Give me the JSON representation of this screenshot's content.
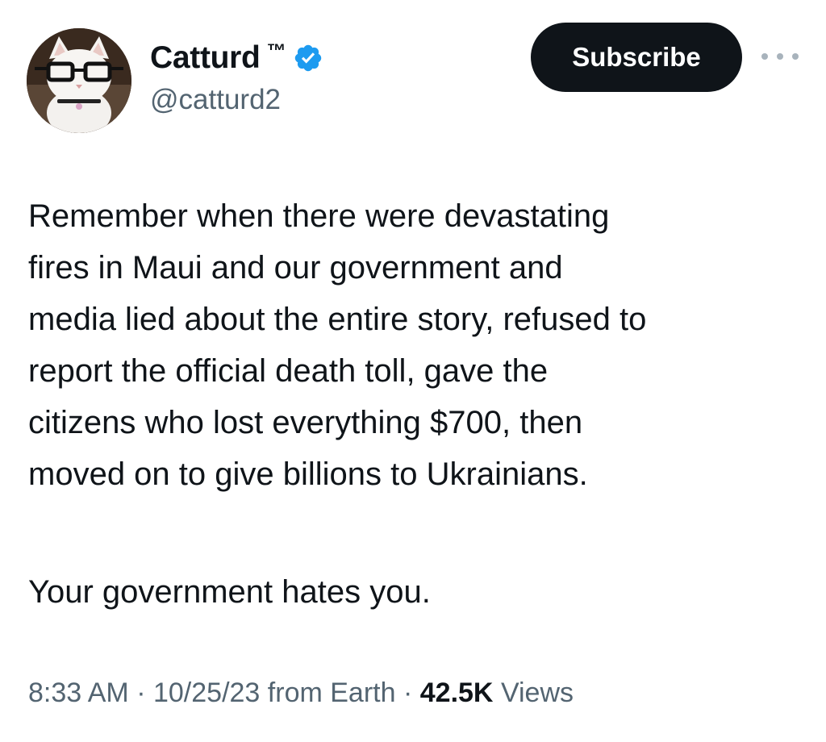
{
  "author": {
    "display_name": "Catturd",
    "trademark": "™",
    "handle": "@catturd2",
    "avatar_icon": "cat-with-glasses-avatar",
    "verified_icon": "verified-badge-icon",
    "verified_color": "#1d9bf0"
  },
  "actions": {
    "subscribe_label": "Subscribe",
    "more_icon": "more-options-icon"
  },
  "tweet": {
    "paragraph1": "Remember when there were devastating\nfires in Maui and our government and\nmedia lied about the entire story, refused to\nreport the official death toll, gave the\ncitizens who lost everything $700, then\nmoved on to give billions to Ukrainians.",
    "paragraph2": "Your government hates you."
  },
  "meta": {
    "time": "8:33 AM",
    "date": "10/25/23",
    "source": "from Earth",
    "separator": "·",
    "views_count": "42.5K",
    "views_label": "Views"
  },
  "colors": {
    "text": "#0f1419",
    "secondary": "#536471",
    "button_bg": "#0f1419"
  }
}
